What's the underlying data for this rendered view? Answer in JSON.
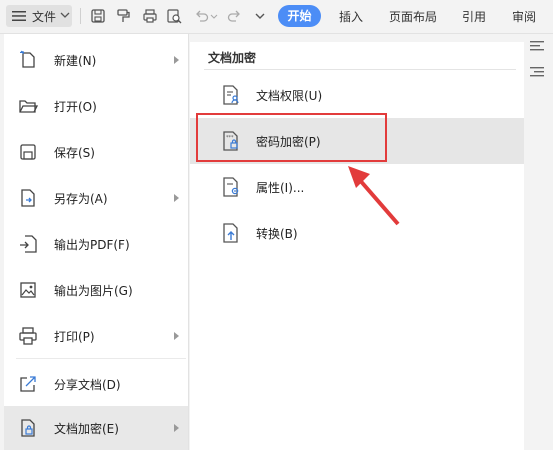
{
  "toolbar": {
    "file_label": "文件",
    "tabs": [
      "开始",
      "插入",
      "页面布局",
      "引用",
      "审阅"
    ],
    "icons": [
      "save-icon",
      "format-painter-icon",
      "print-icon",
      "print-preview-icon",
      "undo-icon",
      "redo-icon",
      "more-icon"
    ]
  },
  "menu": {
    "items": [
      {
        "label": "新建(N)",
        "icon": "new-doc-icon",
        "has_submenu": true
      },
      {
        "label": "打开(O)",
        "icon": "folder-open-icon",
        "has_submenu": false
      },
      {
        "label": "保存(S)",
        "icon": "save-icon",
        "has_submenu": false
      },
      {
        "label": "另存为(A)",
        "icon": "save-as-icon",
        "has_submenu": true
      },
      {
        "label": "输出为PDF(F)",
        "icon": "export-pdf-icon",
        "has_submenu": false
      },
      {
        "label": "输出为图片(G)",
        "icon": "export-image-icon",
        "has_submenu": false
      },
      {
        "label": "打印(P)",
        "icon": "print-icon",
        "has_submenu": true
      },
      {
        "label": "分享文档(D)",
        "icon": "share-icon",
        "has_submenu": false
      },
      {
        "label": "文档加密(E)",
        "icon": "doc-encrypt-icon",
        "has_submenu": true
      }
    ]
  },
  "submenu": {
    "title": "文档加密",
    "items": [
      {
        "label": "文档权限(U)",
        "icon": "doc-permission-icon"
      },
      {
        "label": "密码加密(P)",
        "icon": "password-lock-icon"
      },
      {
        "label": "属性(I)...",
        "icon": "doc-properties-icon"
      },
      {
        "label": "转换(B)",
        "icon": "convert-icon"
      }
    ]
  },
  "colors": {
    "accent": "#4c8df6",
    "highlight": "#e23b3b",
    "icon_blue": "#3a7bd5"
  }
}
